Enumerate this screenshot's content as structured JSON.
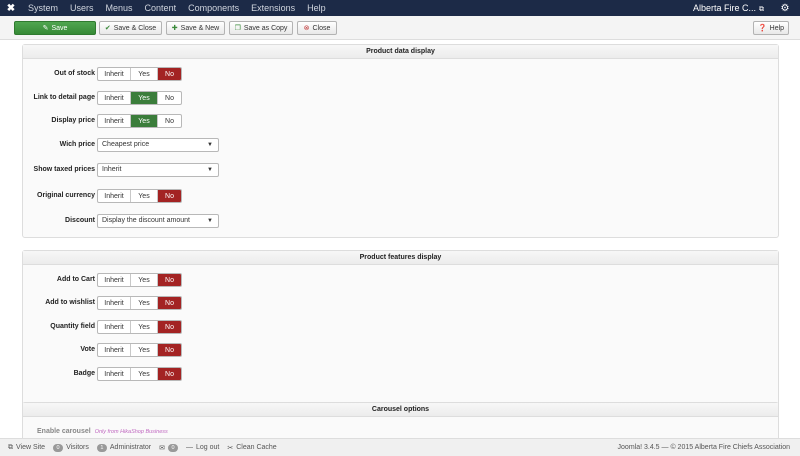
{
  "navbar": {
    "menu": [
      "System",
      "Users",
      "Menus",
      "Content",
      "Components",
      "Extensions",
      "Help"
    ],
    "site_name": "Alberta Fire C..."
  },
  "toolbar": {
    "save": "Save",
    "save_close": "Save & Close",
    "save_new": "Save & New",
    "save_copy": "Save as Copy",
    "close": "Close",
    "help": "Help"
  },
  "toggle_labels": {
    "inherit": "Inherit",
    "yes": "Yes",
    "no": "No"
  },
  "product_data": {
    "title": "Product data display",
    "out_of_stock": {
      "label": "Out of stock",
      "value": "No"
    },
    "link_detail": {
      "label": "Link to detail page",
      "value": "Yes"
    },
    "display_price": {
      "label": "Display price",
      "value": "Yes"
    },
    "which_price": {
      "label": "Wich price",
      "value": "Cheapest price"
    },
    "show_taxed": {
      "label": "Show taxed prices",
      "value": "Inherit"
    },
    "original_currency": {
      "label": "Original currency",
      "value": "No"
    },
    "discount": {
      "label": "Discount",
      "value": "Display the discount amount"
    }
  },
  "product_features": {
    "title": "Product features display",
    "add_to_cart": {
      "label": "Add to Cart",
      "value": "No"
    },
    "add_to_wishlist": {
      "label": "Add to wishlist",
      "value": "No"
    },
    "quantity_field": {
      "label": "Quantity field",
      "value": "No"
    },
    "vote": {
      "label": "Vote",
      "value": "No"
    },
    "badge": {
      "label": "Badge",
      "value": "No"
    }
  },
  "carousel": {
    "title": "Carousel options",
    "enable_label": "Enable carousel",
    "enable_note": "Only from HikaShop Business"
  },
  "statusbar": {
    "view_site": "View Site",
    "visitors_count": "0",
    "visitors": "Visitors",
    "admin_count": "1",
    "administrator": "Administrator",
    "messages_count": "0",
    "log_out": "Log out",
    "clean_cache": "Clean Cache",
    "footer": "Joomla! 3.4.5  —  © 2015 Alberta Fire Chiefs Association"
  },
  "colors": {
    "navbar": "#1c2a47",
    "yes_active": "#3b7d3b",
    "no_active": "#a32323",
    "save_button": "#3f963f"
  }
}
